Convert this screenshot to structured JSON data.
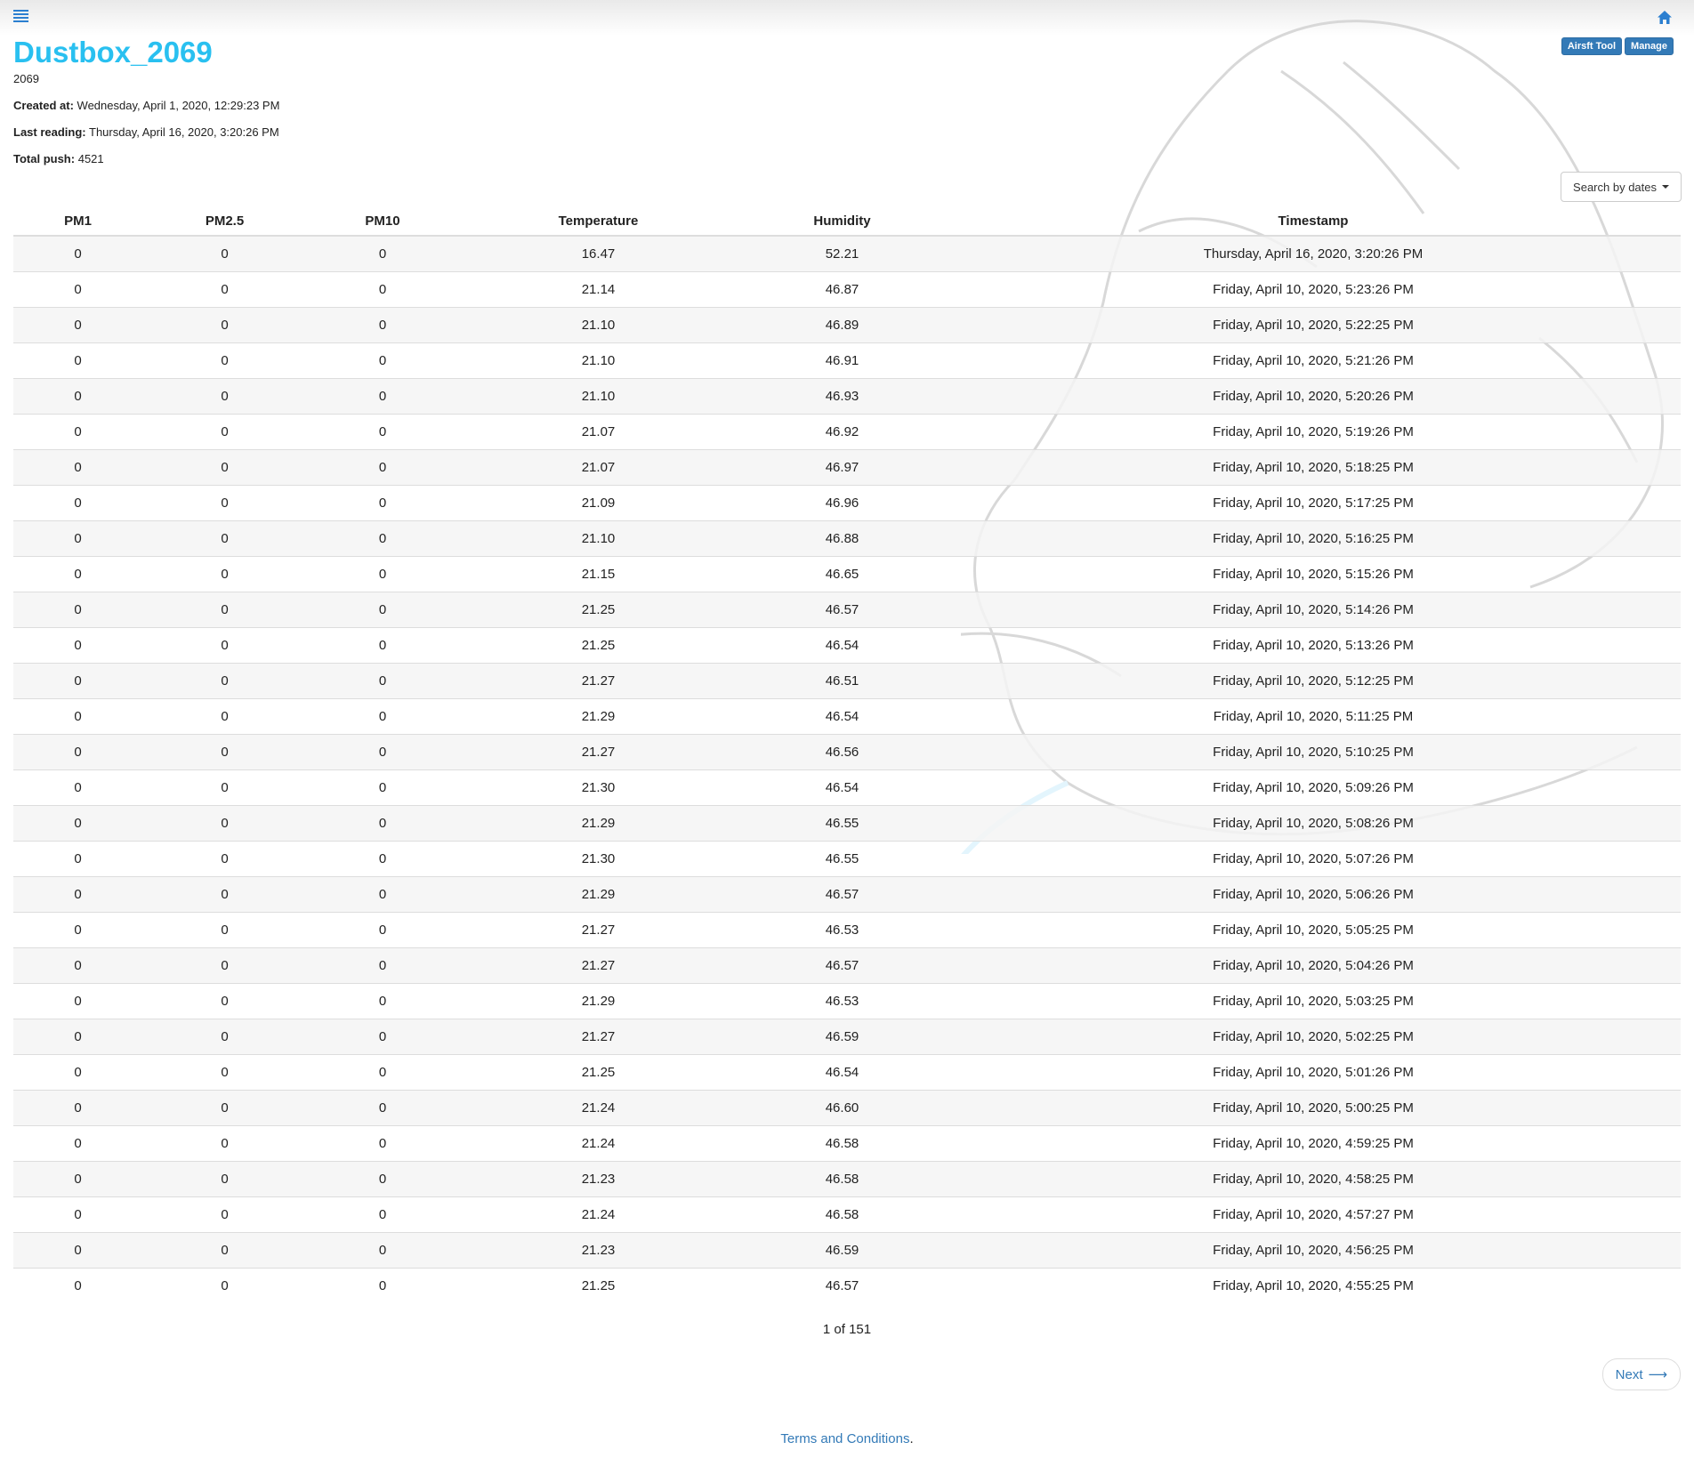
{
  "header": {
    "title": "Dustbox_2069",
    "device_id": "2069",
    "created_label": "Created at:",
    "created_value": "Wednesday, April 1, 2020, 12:29:23 PM",
    "last_reading_label": "Last reading:",
    "last_reading_value": "Thursday, April 16, 2020, 3:20:26 PM",
    "total_push_label": "Total push:",
    "total_push_value": "4521"
  },
  "toolbar": {
    "airsft_tool_label": "Airsft Tool",
    "manage_label": "Manage",
    "search_label": "Search by dates"
  },
  "table": {
    "columns": [
      "PM1",
      "PM2.5",
      "PM10",
      "Temperature",
      "Humidity",
      "Timestamp"
    ],
    "rows": [
      [
        "0",
        "0",
        "0",
        "16.47",
        "52.21",
        "Thursday, April 16, 2020, 3:20:26 PM"
      ],
      [
        "0",
        "0",
        "0",
        "21.14",
        "46.87",
        "Friday, April 10, 2020, 5:23:26 PM"
      ],
      [
        "0",
        "0",
        "0",
        "21.10",
        "46.89",
        "Friday, April 10, 2020, 5:22:25 PM"
      ],
      [
        "0",
        "0",
        "0",
        "21.10",
        "46.91",
        "Friday, April 10, 2020, 5:21:26 PM"
      ],
      [
        "0",
        "0",
        "0",
        "21.10",
        "46.93",
        "Friday, April 10, 2020, 5:20:26 PM"
      ],
      [
        "0",
        "0",
        "0",
        "21.07",
        "46.92",
        "Friday, April 10, 2020, 5:19:26 PM"
      ],
      [
        "0",
        "0",
        "0",
        "21.07",
        "46.97",
        "Friday, April 10, 2020, 5:18:25 PM"
      ],
      [
        "0",
        "0",
        "0",
        "21.09",
        "46.96",
        "Friday, April 10, 2020, 5:17:25 PM"
      ],
      [
        "0",
        "0",
        "0",
        "21.10",
        "46.88",
        "Friday, April 10, 2020, 5:16:25 PM"
      ],
      [
        "0",
        "0",
        "0",
        "21.15",
        "46.65",
        "Friday, April 10, 2020, 5:15:26 PM"
      ],
      [
        "0",
        "0",
        "0",
        "21.25",
        "46.57",
        "Friday, April 10, 2020, 5:14:26 PM"
      ],
      [
        "0",
        "0",
        "0",
        "21.25",
        "46.54",
        "Friday, April 10, 2020, 5:13:26 PM"
      ],
      [
        "0",
        "0",
        "0",
        "21.27",
        "46.51",
        "Friday, April 10, 2020, 5:12:25 PM"
      ],
      [
        "0",
        "0",
        "0",
        "21.29",
        "46.54",
        "Friday, April 10, 2020, 5:11:25 PM"
      ],
      [
        "0",
        "0",
        "0",
        "21.27",
        "46.56",
        "Friday, April 10, 2020, 5:10:25 PM"
      ],
      [
        "0",
        "0",
        "0",
        "21.30",
        "46.54",
        "Friday, April 10, 2020, 5:09:26 PM"
      ],
      [
        "0",
        "0",
        "0",
        "21.29",
        "46.55",
        "Friday, April 10, 2020, 5:08:26 PM"
      ],
      [
        "0",
        "0",
        "0",
        "21.30",
        "46.55",
        "Friday, April 10, 2020, 5:07:26 PM"
      ],
      [
        "0",
        "0",
        "0",
        "21.29",
        "46.57",
        "Friday, April 10, 2020, 5:06:26 PM"
      ],
      [
        "0",
        "0",
        "0",
        "21.27",
        "46.53",
        "Friday, April 10, 2020, 5:05:25 PM"
      ],
      [
        "0",
        "0",
        "0",
        "21.27",
        "46.57",
        "Friday, April 10, 2020, 5:04:26 PM"
      ],
      [
        "0",
        "0",
        "0",
        "21.29",
        "46.53",
        "Friday, April 10, 2020, 5:03:25 PM"
      ],
      [
        "0",
        "0",
        "0",
        "21.27",
        "46.59",
        "Friday, April 10, 2020, 5:02:25 PM"
      ],
      [
        "0",
        "0",
        "0",
        "21.25",
        "46.54",
        "Friday, April 10, 2020, 5:01:26 PM"
      ],
      [
        "0",
        "0",
        "0",
        "21.24",
        "46.60",
        "Friday, April 10, 2020, 5:00:25 PM"
      ],
      [
        "0",
        "0",
        "0",
        "21.24",
        "46.58",
        "Friday, April 10, 2020, 4:59:25 PM"
      ],
      [
        "0",
        "0",
        "0",
        "21.23",
        "46.58",
        "Friday, April 10, 2020, 4:58:25 PM"
      ],
      [
        "0",
        "0",
        "0",
        "21.24",
        "46.58",
        "Friday, April 10, 2020, 4:57:27 PM"
      ],
      [
        "0",
        "0",
        "0",
        "21.23",
        "46.59",
        "Friday, April 10, 2020, 4:56:25 PM"
      ],
      [
        "0",
        "0",
        "0",
        "21.25",
        "46.57",
        "Friday, April 10, 2020, 4:55:25 PM"
      ]
    ]
  },
  "pagination": {
    "page_text": "1 of 151",
    "next_label": "Next",
    "next_arrow": "⟶"
  },
  "footer": {
    "terms_label": "Terms and Conditions",
    "terms_suffix": "."
  },
  "icons": {
    "menu": "menu-icon",
    "home": "home-icon",
    "caret": "caret-down-icon"
  },
  "colors": {
    "title": "#29c0f0",
    "primary": "#337ab7"
  }
}
